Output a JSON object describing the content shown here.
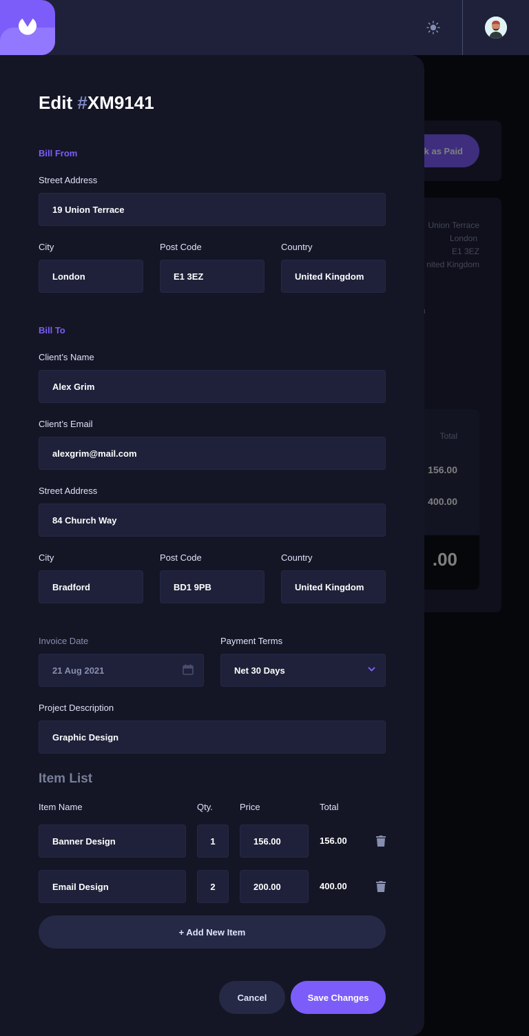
{
  "background_invoice": {
    "mark_paid_label": "k as Paid",
    "sender_address": [
      "Union Terrace",
      "London",
      "E1 3EZ",
      "nited Kingdom"
    ],
    "client_name_partial": "m",
    "items_header_total": "Total",
    "item_totals": [
      "156.00",
      "400.00"
    ],
    "amount_due_partial": ".00"
  },
  "form": {
    "title_prefix": "Edit ",
    "title_hash": "#",
    "title_id": "XM9141",
    "bill_from": {
      "section_label": "Bill From",
      "street_label": "Street Address",
      "street_value": "19 Union Terrace",
      "city_label": "City",
      "city_value": "London",
      "postcode_label": "Post Code",
      "postcode_value": "E1 3EZ",
      "country_label": "Country",
      "country_value": "United Kingdom"
    },
    "bill_to": {
      "section_label": "Bill To",
      "name_label": "Client’s Name",
      "name_value": "Alex Grim",
      "email_label": "Client’s Email",
      "email_value": "alexgrim@mail.com",
      "street_label": "Street Address",
      "street_value": "84 Church Way",
      "city_label": "City",
      "city_value": "Bradford",
      "postcode_label": "Post Code",
      "postcode_value": "BD1 9PB",
      "country_label": "Country",
      "country_value": "United Kingdom"
    },
    "invoice_date_label": "Invoice Date",
    "invoice_date_value": "21 Aug 2021",
    "payment_terms_label": "Payment Terms",
    "payment_terms_value": "Net 30 Days",
    "project_label": "Project Description",
    "project_value": "Graphic Design"
  },
  "item_list": {
    "title": "Item List",
    "headers": {
      "name": "Item Name",
      "qty": "Qty.",
      "price": "Price",
      "total": "Total"
    },
    "items": [
      {
        "name": "Banner Design",
        "qty": "1",
        "price": "156.00",
        "total": "156.00"
      },
      {
        "name": "Email Design",
        "qty": "2",
        "price": "200.00",
        "total": "400.00"
      }
    ],
    "add_label": "+ Add New Item"
  },
  "actions": {
    "cancel_label": "Cancel",
    "save_label": "Save Changes"
  },
  "colors": {
    "accent": "#7c5dfa",
    "accent_light": "#9277ff",
    "surface": "#1e2139",
    "background": "#141625"
  }
}
